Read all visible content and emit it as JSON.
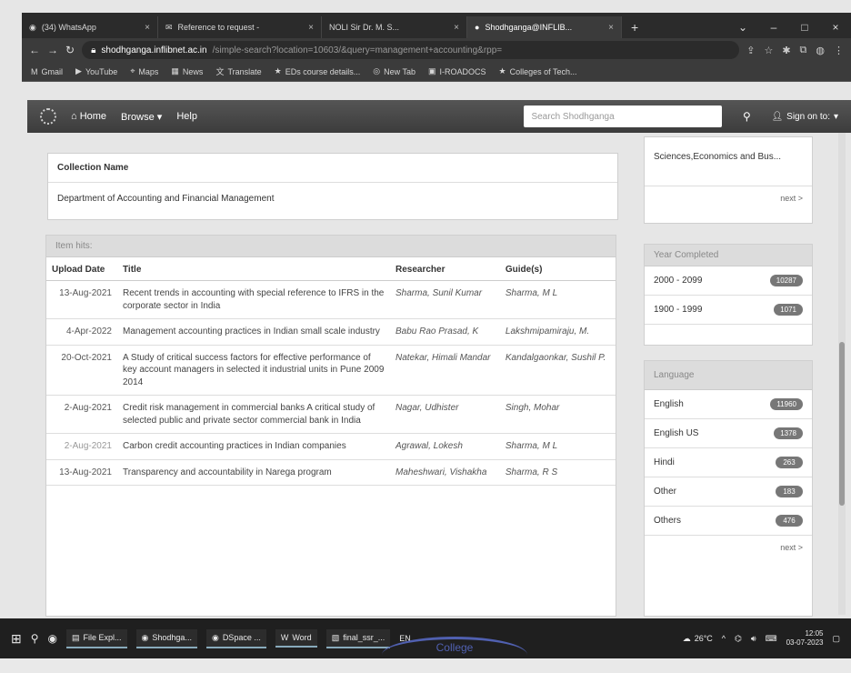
{
  "browser": {
    "tabs": [
      {
        "label": "(34) WhatsApp"
      },
      {
        "label": "Reference to request -"
      },
      {
        "label": "NOLI Sir Dr. M. S..."
      },
      {
        "label": "Shodhganga@INFLIB..."
      }
    ],
    "url_host": "shodhganga.inflibnet.ac.in",
    "url_rest": "/simple-search?location=10603/&query=management+accounting&rpp=",
    "bookmarks": [
      "Gmail",
      "YouTube",
      "Maps",
      "News",
      "Translate",
      "EDs course details...",
      "New Tab",
      "I-ROADOCS",
      "Colleges of Tech..."
    ]
  },
  "site": {
    "nav": {
      "home": "Home",
      "browse": "Browse",
      "help": "Help"
    },
    "search_placeholder": "Search Shodhganga",
    "signin": "Sign on to:"
  },
  "collection": {
    "header": "Collection Name",
    "value": "Department of Accounting and Financial Management"
  },
  "item_hits": {
    "header": "Item hits:",
    "columns": {
      "date": "Upload Date",
      "title": "Title",
      "researcher": "Researcher",
      "guide": "Guide(s)"
    },
    "rows": [
      {
        "date": "13-Aug-2021",
        "title": "Recent trends in accounting with special reference to IFRS in the corporate sector in India",
        "researcher": "Sharma, Sunil Kumar",
        "guide": "Sharma, M L"
      },
      {
        "date": "4-Apr-2022",
        "title": "Management accounting practices in Indian small scale industry",
        "researcher": "Babu Rao Prasad, K",
        "guide": "Lakshmipamiraju, M."
      },
      {
        "date": "20-Oct-2021",
        "title": "A Study of critical success factors for effective performance of key account managers in selected it industrial units in Pune 2009 2014",
        "researcher": "Natekar, Himali Mandar",
        "guide": "Kandalgaonkar, Sushil P."
      },
      {
        "date": "2-Aug-2021",
        "title": "Credit risk management in commercial banks A critical study of selected public and private sector commercial bank in India",
        "researcher": "Nagar, Udhister",
        "guide": "Singh, Mohar"
      },
      {
        "date": "2-Aug-2021",
        "title": "Carbon credit accounting practices in Indian companies",
        "researcher": "Agrawal, Lokesh",
        "guide": "Sharma, M L"
      },
      {
        "date": "13-Aug-2021",
        "title": "Transparency and accountability in Narega program",
        "researcher": "Maheshwari, Vishakha",
        "guide": "Sharma, R S"
      }
    ]
  },
  "sidebar": {
    "top_text": "Sciences,Economics and Bus...",
    "next": "next >",
    "year_header": "Year Completed",
    "years": [
      {
        "label": "2000 - 2099",
        "count": "10287"
      },
      {
        "label": "1900 - 1999",
        "count": "1071"
      }
    ],
    "lang_header": "Language",
    "languages": [
      {
        "label": "English",
        "count": "11960"
      },
      {
        "label": "English US",
        "count": "1378"
      },
      {
        "label": "Hindi",
        "count": "263"
      },
      {
        "label": "Other",
        "count": "183"
      },
      {
        "label": "Others",
        "count": "476"
      }
    ],
    "lang_next": "next >"
  },
  "taskbar": {
    "apps": [
      "File Expl...",
      "Shodhga...",
      "DSpace ...",
      "Word",
      "final_ssr_..."
    ],
    "lang": "EN",
    "weather": "26°C",
    "time": "12:05",
    "date": "03-07-2023"
  },
  "stamp": "College"
}
